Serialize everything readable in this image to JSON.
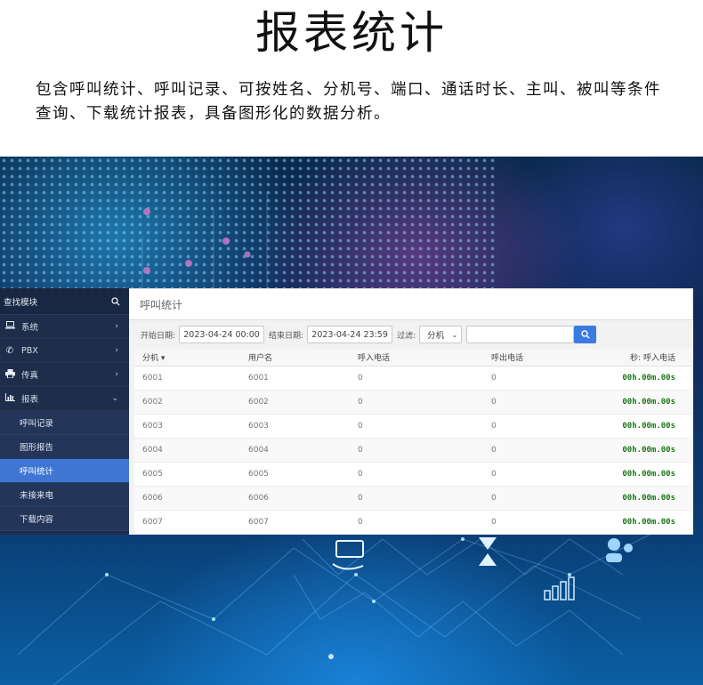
{
  "page": {
    "title": "报表统计",
    "description": "包含呼叫统计、呼叫记录、可按姓名、分机号、端口、通话时长、主叫、被叫等条件查询、下载统计报表，具备图形化的数据分析。"
  },
  "sidebar": {
    "header": "查找模块",
    "items": [
      {
        "label": "系统",
        "icon": "laptop-icon"
      },
      {
        "label": "PBX",
        "icon": "phone-icon"
      },
      {
        "label": "传真",
        "icon": "printer-icon"
      },
      {
        "label": "报表",
        "icon": "bar-chart-icon"
      }
    ],
    "subitems": [
      {
        "label": "呼叫记录"
      },
      {
        "label": "图形报告"
      },
      {
        "label": "呼叫统计",
        "active": true
      },
      {
        "label": "未接来电"
      },
      {
        "label": "下载内容"
      }
    ]
  },
  "main": {
    "header": "呼叫统计",
    "filter": {
      "start_label": "开始日期:",
      "start_value": "2023-04-24 00:00",
      "end_label": "结束日期:",
      "end_value": "2023-04-24 23:59",
      "filter_label": "过滤:",
      "filter_select": "分机",
      "search_value": ""
    },
    "table": {
      "columns": [
        "分机 ▾",
        "用户名",
        "呼入电话",
        "呼出电话",
        "秒: 呼入电话"
      ],
      "rows": [
        [
          "6001",
          "6001",
          "0",
          "0",
          "00h.00m.00s"
        ],
        [
          "6002",
          "6002",
          "0",
          "0",
          "00h.00m.00s"
        ],
        [
          "6003",
          "6003",
          "0",
          "0",
          "00h.00m.00s"
        ],
        [
          "6004",
          "6004",
          "0",
          "0",
          "00h.00m.00s"
        ],
        [
          "6005",
          "6005",
          "0",
          "0",
          "00h.00m.00s"
        ],
        [
          "6006",
          "6006",
          "0",
          "0",
          "00h.00m.00s"
        ],
        [
          "6007",
          "6007",
          "0",
          "0",
          "00h.00m.00s"
        ]
      ]
    }
  },
  "colors": {
    "sidebar_bg": "#1e2d4a",
    "active_item": "#3f76d4",
    "search_button": "#3a7be0",
    "duration_text": "#157a15"
  }
}
